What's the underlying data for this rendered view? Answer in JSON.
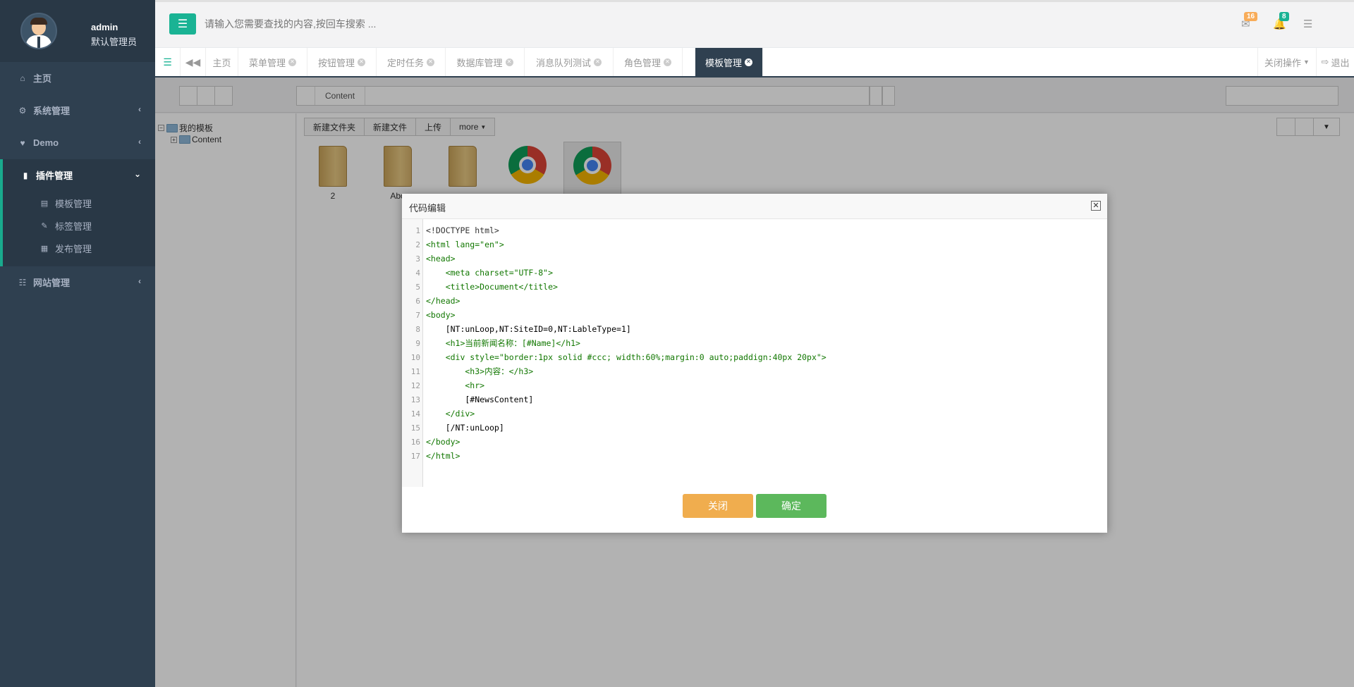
{
  "profile": {
    "name": "admin",
    "role": "默认管理员"
  },
  "sidebar": {
    "items": [
      {
        "label": "主页",
        "icon": "home-icon"
      },
      {
        "label": "系统管理",
        "icon": "gear-icon"
      },
      {
        "label": "Demo",
        "icon": "heart-icon"
      },
      {
        "label": "插件管理",
        "icon": "bookmark-icon"
      },
      {
        "label": "网站管理",
        "icon": "sitemap-icon"
      }
    ],
    "sub_items": [
      {
        "label": "模板管理",
        "icon": "file-icon"
      },
      {
        "label": "标签管理",
        "icon": "eraser-icon"
      },
      {
        "label": "发布管理",
        "icon": "grid-icon"
      }
    ]
  },
  "header": {
    "search_placeholder": "请输入您需要查找的内容,按回车搜索 ...",
    "mail_count": "16",
    "bell_count": "8",
    "mail_badge_color": "#f8ac59",
    "bell_badge_color": "#1ab394"
  },
  "tabs": {
    "items": [
      {
        "label": "主页"
      },
      {
        "label": "菜单管理"
      },
      {
        "label": "按钮管理"
      },
      {
        "label": "定时任务"
      },
      {
        "label": "数据库管理"
      },
      {
        "label": "消息队列测试"
      },
      {
        "label": "角色管理"
      },
      {
        "label": "模板管理"
      }
    ],
    "close_ops": "关闭操作",
    "logout": "退出"
  },
  "files": {
    "breadcrumb": "Content",
    "toolbar": [
      "新建文件夹",
      "新建文件",
      "上传",
      "more"
    ],
    "tree": {
      "root": "我的模板",
      "child": "Content"
    },
    "items": [
      {
        "name": "2",
        "type": "folder"
      },
      {
        "name": "Abo",
        "type": "folder"
      },
      {
        "name": "",
        "type": "folder"
      },
      {
        "name": "",
        "type": "chrome"
      },
      {
        "name": "",
        "type": "chrome"
      }
    ]
  },
  "dialog": {
    "title": "代码编辑",
    "cancel": "关闭",
    "confirm": "确定",
    "cancel_color": "#f0ad4e",
    "confirm_color": "#5cb85c",
    "code": [
      "<!DOCTYPE html>",
      "<html lang=\"en\">",
      "<head>",
      "    <meta charset=\"UTF-8\">",
      "    <title>Document</title>",
      "</head>",
      "<body>",
      "    [NT:unLoop,NT:SiteID=0,NT:LableType=1]",
      "    <h1>当前新闻名称：[#Name]</h1>",
      "    <div style=\"border:1px solid #ccc; width:60%;margin:0 auto;paddign:40px 20px\">",
      "        <h3>内容：</h3>",
      "        <hr>",
      "        [#NewsContent]",
      "    </div>",
      "    [/NT:unLoop]",
      "</body>",
      "</html>"
    ]
  }
}
